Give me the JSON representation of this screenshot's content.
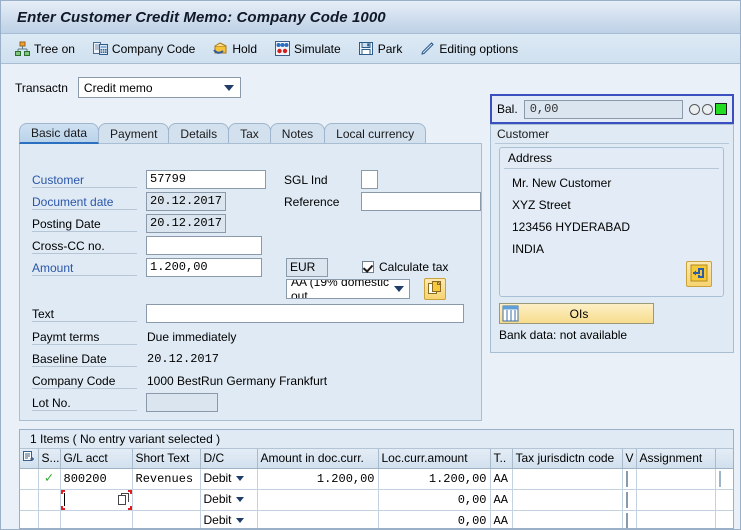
{
  "window": {
    "title": "Enter Customer Credit Memo: Company Code 1000"
  },
  "toolbar": {
    "items": [
      {
        "label": "Tree on",
        "icon": "tree-icon"
      },
      {
        "label": "Company Code",
        "icon": "company-code-icon"
      },
      {
        "label": "Hold",
        "icon": "hold-icon"
      },
      {
        "label": "Simulate",
        "icon": "simulate-icon"
      },
      {
        "label": "Park",
        "icon": "park-save-icon"
      },
      {
        "label": "Editing options",
        "icon": "pencil-icon"
      }
    ]
  },
  "transaction": {
    "label": "Transactn",
    "value": "Credit memo"
  },
  "tabs": [
    {
      "label": "Basic data",
      "active": true
    },
    {
      "label": "Payment",
      "active": false
    },
    {
      "label": "Details",
      "active": false
    },
    {
      "label": "Tax",
      "active": false
    },
    {
      "label": "Notes",
      "active": false
    },
    {
      "label": "Local currency",
      "active": false
    }
  ],
  "basic_data": {
    "customer_label": "Customer",
    "customer_value": "57799",
    "sgl_ind_label": "SGL Ind",
    "sgl_ind_value": "",
    "document_date_label": "Document date",
    "document_date_value": "20.12.2017",
    "reference_label": "Reference",
    "reference_value": "",
    "posting_date_label": "Posting Date",
    "posting_date_value": "20.12.2017",
    "cross_cc_label": "Cross-CC no.",
    "cross_cc_value": "",
    "amount_label": "Amount",
    "amount_value": "1.200,00",
    "currency_value": "EUR",
    "calculate_tax_label": "Calculate tax",
    "calculate_tax_checked": true,
    "tax_code_value": "AA (19% domestic out…",
    "text_label": "Text",
    "text_value": "",
    "paymt_terms_label": "Paymt terms",
    "paymt_terms_value": "Due immediately",
    "baseline_date_label": "Baseline Date",
    "baseline_date_value": "20.12.2017",
    "company_code_label": "Company Code",
    "company_code_value": "1000 BestRun Germany Frankfurt",
    "lot_no_label": "Lot No.",
    "lot_no_value": "",
    "tax_detail_button_icon": "tax-detail-icon"
  },
  "balance": {
    "label": "Bal.",
    "value": "0,00",
    "traffic_light": "green",
    "light_color": "#22dd22"
  },
  "customer_panel": {
    "group_title": "Customer",
    "address_title": "Address",
    "address_lines": [
      "Mr. New Customer",
      "XYZ Street",
      "123456 HYDERABAD",
      "INDIA"
    ],
    "address_detail_button_icon": "address-detail-icon",
    "ois_button_label": "OIs",
    "ois_button_icon": "open-items-icon",
    "bank_data_text": "Bank data: not available"
  },
  "items_table": {
    "caption": "1 Items ( No entry variant selected )",
    "columns": [
      "",
      "S...",
      "G/L acct",
      "Short Text",
      "D/C",
      "Amount in doc.curr.",
      "Loc.curr.amount",
      "T..",
      "Tax jurisdictn code",
      "V",
      "Assignment",
      ""
    ],
    "rows": [
      {
        "status": "ok",
        "gl_acct": "800200",
        "short_text": "Revenues",
        "dc": "Debit",
        "amount_doc": "1.200,00",
        "amount_loc": "1.200,00",
        "tax": "AA",
        "tax_jurisdictn": "",
        "v": false,
        "assignment": ""
      },
      {
        "status": "empty",
        "gl_acct": "",
        "short_text": "",
        "dc": "Debit",
        "amount_doc": "",
        "amount_loc": "0,00",
        "tax": "AA",
        "tax_jurisdictn": "",
        "v": false,
        "assignment": "",
        "focused": true
      },
      {
        "status": "empty",
        "gl_acct": "",
        "short_text": "",
        "dc": "Debit",
        "amount_doc": "",
        "amount_loc": "0,00",
        "tax": "AA",
        "tax_jurisdictn": "",
        "v": false,
        "assignment": ""
      }
    ]
  }
}
